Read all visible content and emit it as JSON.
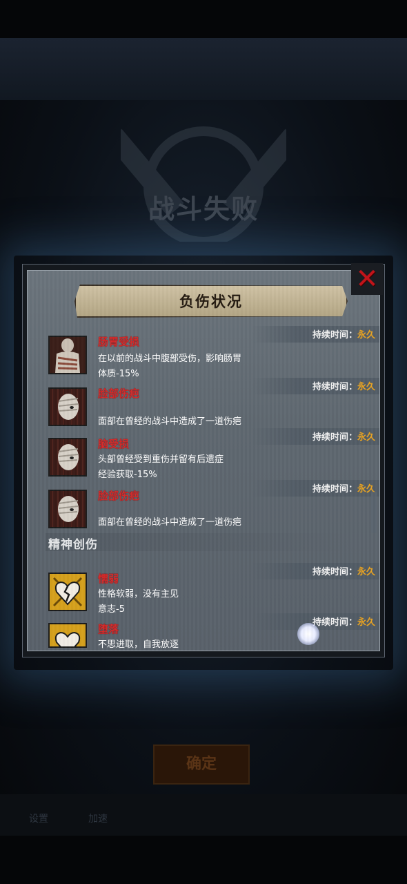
{
  "background": {
    "title": "战斗失败",
    "confirm_label": "确定",
    "tabs": [
      "设置",
      "加速"
    ]
  },
  "panel": {
    "title": "负伤状况",
    "close_icon": "close-x-icon",
    "duration_label": "持续时间：",
    "section_mental": "精神创伤",
    "physical": [
      {
        "name": "肠胃受损",
        "desc": "在以前的战斗中腹部受伤，影响肠胃",
        "effect": "体质-15%",
        "duration": "永久",
        "icon": "bandaged-torso-portrait"
      },
      {
        "name": "脸部伤疤",
        "desc": "面部在曾经的战斗中造成了一道伤疤",
        "effect": "",
        "duration": "永久",
        "icon": "bandaged-face-portrait"
      },
      {
        "name": "脑受损",
        "desc": "头部曾经受到重伤并留有后遗症",
        "effect": "经验获取-15%",
        "duration": "永久",
        "icon": "bandaged-face-portrait"
      },
      {
        "name": "脸部伤疤",
        "desc": "面部在曾经的战斗中造成了一道伤疤",
        "effect": "",
        "duration": "永久",
        "icon": "bandaged-face-portrait"
      }
    ],
    "mental": [
      {
        "name": "懦弱",
        "desc": "性格软弱，没有主见",
        "effect": "意志-5",
        "duration": "永久",
        "icon": "broken-heart-icon"
      },
      {
        "name": "堕落",
        "desc": "不思进取，自我放逐",
        "effect": "",
        "duration": "永久",
        "icon": "broken-heart-icon"
      }
    ]
  }
}
